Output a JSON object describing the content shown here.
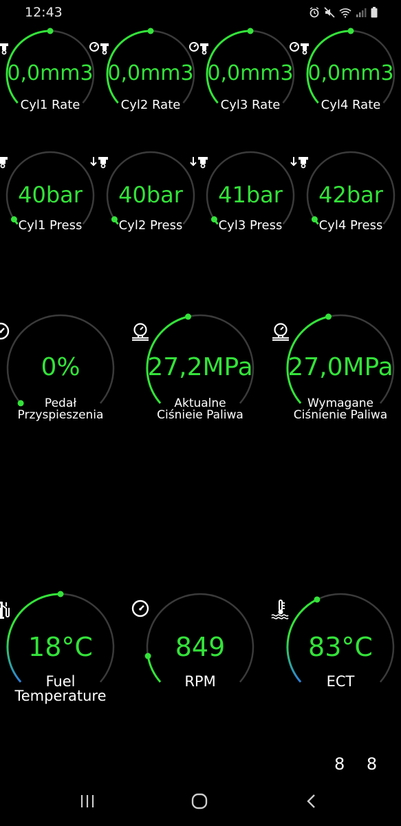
{
  "status": {
    "time": "12:43",
    "icons": [
      "alarm-icon",
      "mute-icon",
      "wifi-icon",
      "signal-icon",
      "battery-icon"
    ]
  },
  "colors": {
    "accent": "#34e23a",
    "ring": "#3a3a3a",
    "cold": "#2f7fd8"
  },
  "rows": [
    {
      "gauges": [
        {
          "value": "0,0mm3",
          "label": "Cyl1 Rate",
          "icon": "injector-rate-icon",
          "level": 0.5
        },
        {
          "value": "0,0mm3",
          "label": "Cyl2 Rate",
          "icon": "injector-rate-icon",
          "level": 0.5
        },
        {
          "value": "0,0mm3",
          "label": "Cyl3 Rate",
          "icon": "injector-rate-icon",
          "level": 0.5
        },
        {
          "value": "0,0mm3",
          "label": "Cyl4 Rate",
          "icon": "injector-rate-icon",
          "level": 0.5
        }
      ]
    },
    {
      "gauges": [
        {
          "value": "40bar",
          "label": "Cyl1 Press",
          "icon": "injector-press-icon",
          "level": 0.03
        },
        {
          "value": "40bar",
          "label": "Cyl2 Press",
          "icon": "injector-press-icon",
          "level": 0.03
        },
        {
          "value": "41bar",
          "label": "Cyl3 Press",
          "icon": "injector-press-icon",
          "level": 0.03
        },
        {
          "value": "42bar",
          "label": "Cyl4 Press",
          "icon": "injector-press-icon",
          "level": 0.03
        }
      ]
    },
    {
      "gauges": [
        {
          "value": "0%",
          "label": "Pedał\nPrzyspieszenia",
          "icon": "speedometer-icon",
          "level": 0.0
        },
        {
          "value": "27,2MPa",
          "label": "Aktualne\nCiśnieie Paliwa",
          "icon": "pressure-gauge-icon",
          "level": 0.45
        },
        {
          "value": "27,0MPa",
          "label": "Wymagane\nCiśnienie Paliwa",
          "icon": "pressure-gauge-icon",
          "level": 0.45
        }
      ]
    },
    {
      "gauges": [
        {
          "value": "18°C",
          "label": "Fuel\nTemperature",
          "icon": "fuel-temp-icon",
          "level": 0.5,
          "cold": true
        },
        {
          "value": "849",
          "label": "RPM",
          "icon": "speedometer-icon",
          "level": 0.12
        },
        {
          "value": "83°C",
          "label": "ECT",
          "icon": "coolant-temp-icon",
          "level": 0.4,
          "cold": true
        }
      ]
    }
  ],
  "page": "8 8",
  "nav": {
    "recents": "recents-icon",
    "home": "home-icon",
    "back": "back-icon"
  }
}
